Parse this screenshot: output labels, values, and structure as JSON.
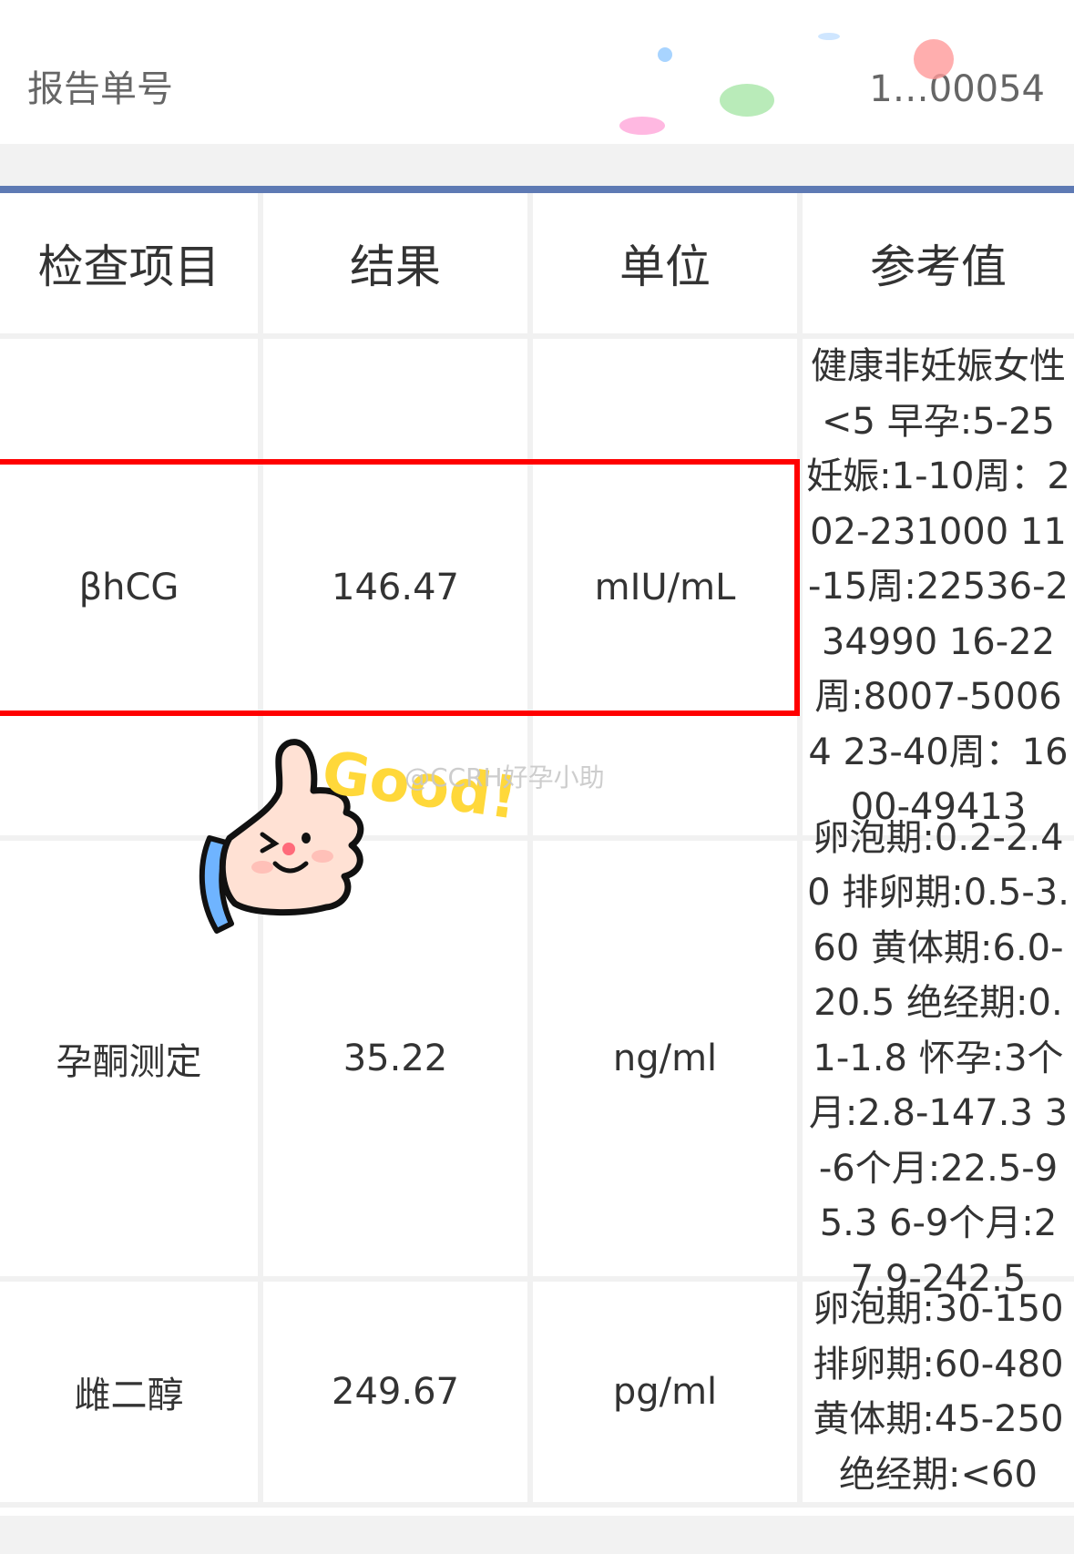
{
  "report": {
    "label": "报告单号",
    "number_visible": "1…00054"
  },
  "table": {
    "headers": [
      "检查项目",
      "结果",
      "单位",
      "参考值"
    ],
    "rows": [
      {
        "item": "βhCG",
        "result": "146.47",
        "unit": "mIU/mL",
        "reference": "健康非妊娠女性<5 早孕:5-25 妊娠:1-10周：202-231000 11-15周:22536-234990 16-22周:8007-50064 23-40周：1600-49413"
      },
      {
        "item": "孕酮测定",
        "result": "35.22",
        "unit": "ng/ml",
        "reference": "卵泡期:0.2-2.40 排卵期:0.5-3.60 黄体期:6.0-20.5 绝经期:0.1-1.8 怀孕:3个月:2.8-147.3 3-6个月:22.5-95.3 6-9个月:27.9-242.5"
      },
      {
        "item": "雌二醇",
        "result": "249.67",
        "unit": "pg/ml",
        "reference": "卵泡期:30-150 排卵期:60-480 黄体期:45-250 绝经期:<60"
      }
    ]
  },
  "sticker": {
    "text": "Good!",
    "icon": "thumbs-up-icon"
  },
  "watermark": "@CCRH好孕小助",
  "colors": {
    "highlight": "#ff0000",
    "header_line": "#5e7ab4"
  }
}
